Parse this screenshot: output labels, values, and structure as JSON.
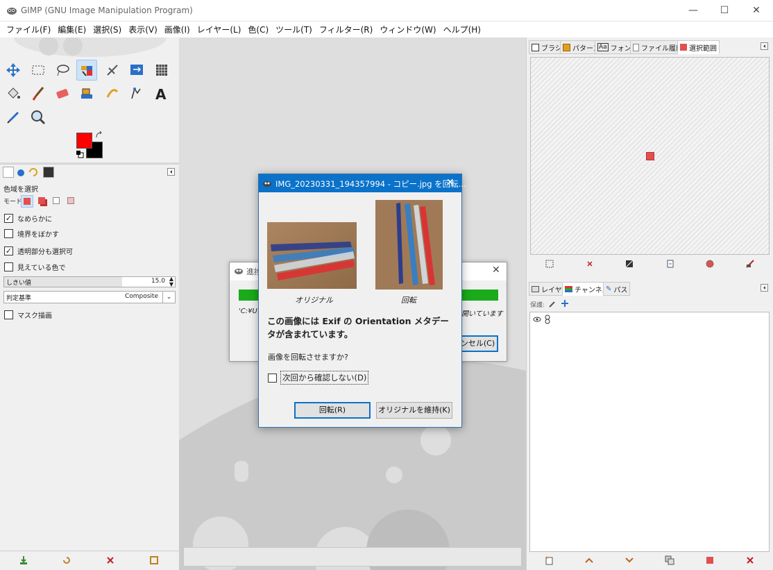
{
  "window": {
    "title": "GIMP (GNU Image Manipulation Program)",
    "minimize_glyph": "—",
    "maximize_glyph": "☐",
    "close_glyph": "✕"
  },
  "menubar": {
    "items": [
      "ファイル(F)",
      "編集(E)",
      "選択(S)",
      "表示(V)",
      "画像(I)",
      "レイヤー(L)",
      "色(C)",
      "ツール(T)",
      "フィルター(R)",
      "ウィンドウ(W)",
      "ヘルプ(H)"
    ]
  },
  "colors": {
    "foreground": "#ff0000",
    "background": "#000000",
    "accent": "#0b72c9",
    "progress": "#1aaa1a"
  },
  "tool_options": {
    "title": "色域を選択",
    "mode_label": "モード:",
    "antialias": {
      "label": "なめらかに",
      "checked": true
    },
    "feather": {
      "label": "境界をぼかす",
      "checked": false
    },
    "select_transparent": {
      "label": "透明部分も選択可",
      "checked": true
    },
    "sample_merged": {
      "label": "見えている色で",
      "checked": false
    },
    "threshold": {
      "label": "しきい値",
      "value": "15.0"
    },
    "criterion": {
      "label": "判定基準",
      "value": "Composite"
    },
    "draw_mask": {
      "label": "マスク描画",
      "checked": false
    }
  },
  "right_top": {
    "tabs": [
      "ブラシ",
      "パターン",
      "フォント",
      "ファイル履歴",
      "選択範囲"
    ],
    "font_tab_icon_text": "Aa"
  },
  "right_bottom": {
    "tabs": [
      "レイヤー",
      "チャンネル",
      "パス"
    ],
    "lock_label": "保護:"
  },
  "progress_dialog": {
    "title": "進捗",
    "message_left": "'C:¥U",
    "message_right": "開いています",
    "cancel_label": "ンセル(C)"
  },
  "rotate_dialog": {
    "title": "IMG_20230331_194357994 - コピー.jpg を回転...",
    "original_caption": "オリジナル",
    "rotated_caption": "回転",
    "headline": "この画像には Exif の Orientation メタデータが含まれています。",
    "question": "画像を回転させますか?",
    "dont_ask": {
      "label": "次回から確認しない(D)",
      "checked": false
    },
    "rotate_button": "回転(R)",
    "keep_button": "オリジナルを維持(K)"
  }
}
